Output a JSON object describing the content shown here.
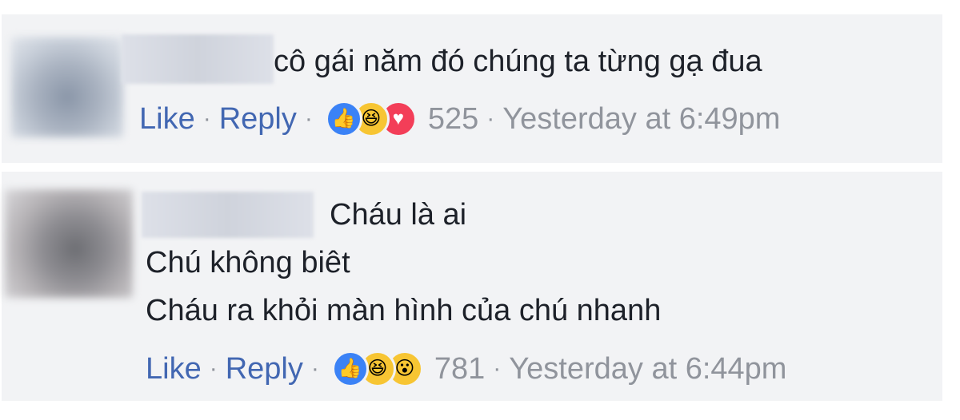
{
  "comments": [
    {
      "lines": [
        "cô gái năm đó chúng ta từng gạ đua"
      ],
      "like_label": "Like",
      "reply_label": "Reply",
      "reactions": [
        "like-icon",
        "haha-icon",
        "love-icon"
      ],
      "reaction_count": "525",
      "timestamp": "Yesterday at 6:49pm"
    },
    {
      "lines": [
        "Cháu là ai",
        "Chú không biêt",
        "Cháu ra khỏi màn hình của chú nhanh"
      ],
      "like_label": "Like",
      "reply_label": "Reply",
      "reactions": [
        "like-icon",
        "haha-icon",
        "wow-icon"
      ],
      "reaction_count": "781",
      "timestamp": "Yesterday at 6:44pm"
    }
  ],
  "separator": "·",
  "colors": {
    "link": "#4267b2",
    "meta": "#90949c",
    "text": "#1d2129",
    "comment_bg": "#f2f3f5",
    "like": "#3b82f6",
    "haha": "#f7c533",
    "love": "#f33e58"
  }
}
